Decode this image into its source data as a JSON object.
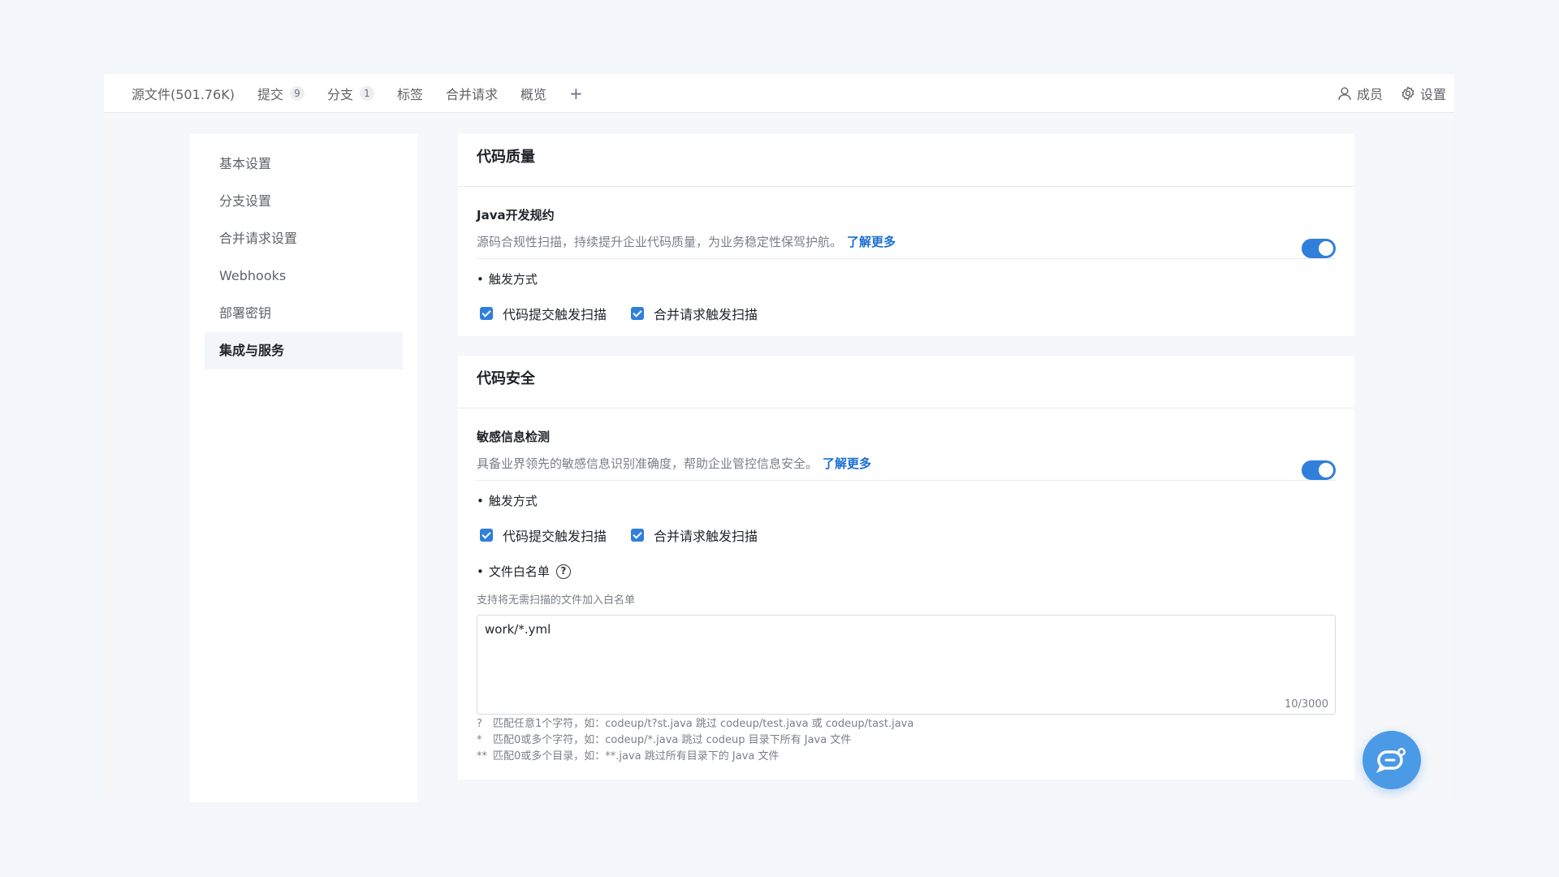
{
  "nav": {
    "tabs": [
      {
        "label": "源文件(501.76K)",
        "badge": ""
      },
      {
        "label": "提交",
        "badge": "9"
      },
      {
        "label": "分支",
        "badge": "1"
      },
      {
        "label": "标签",
        "badge": ""
      },
      {
        "label": "合并请求",
        "badge": ""
      },
      {
        "label": "概览",
        "badge": ""
      }
    ],
    "plus": "+",
    "members": "成员",
    "settings": "设置"
  },
  "sidebar": {
    "items": [
      {
        "label": "基本设置"
      },
      {
        "label": "分支设置"
      },
      {
        "label": "合并请求设置"
      },
      {
        "label": "Webhooks"
      },
      {
        "label": "部署密钥"
      },
      {
        "label": "集成与服务"
      }
    ],
    "active": "集成与服务"
  },
  "quality": {
    "title": "代码质量",
    "rule_title": "Java开发规约",
    "rule_desc": "源码合规性扫描，持续提升企业代码质量，为业务稳定性保驾护航。",
    "learn_more": "了解更多",
    "enabled": true,
    "trigger_label": "触发方式",
    "check_commit": "代码提交触发扫描",
    "check_mr": "合并请求触发扫描"
  },
  "security": {
    "title": "代码安全",
    "rule_title": "敏感信息检测",
    "rule_desc": "具备业界领先的敏感信息识别准确度，帮助企业管控信息安全。",
    "learn_more": "了解更多",
    "enabled": true,
    "trigger_label": "触发方式",
    "check_commit": "代码提交触发扫描",
    "check_mr": "合并请求触发扫描",
    "whitelist_label": "文件白名单",
    "whitelist_hint": "支持将无需扫描的文件加入白名单",
    "whitelist_value": "work/*.yml",
    "counter": "10/3000",
    "rules": [
      {
        "sym": "?",
        "text": "匹配任意1个字符，如：codeup/t?st.java 跳过 codeup/test.java 或 codeup/tast.java"
      },
      {
        "sym": "*",
        "text": "匹配0或多个字符，如：codeup/*.java 跳过 codeup 目录下所有 Java 文件"
      },
      {
        "sym": "**",
        "text": "匹配0或多个目录，如：**.java 跳过所有目录下的 Java 文件"
      }
    ]
  },
  "colors": {
    "accent": "#2f7fdb",
    "fab": "#4a9ae6"
  }
}
